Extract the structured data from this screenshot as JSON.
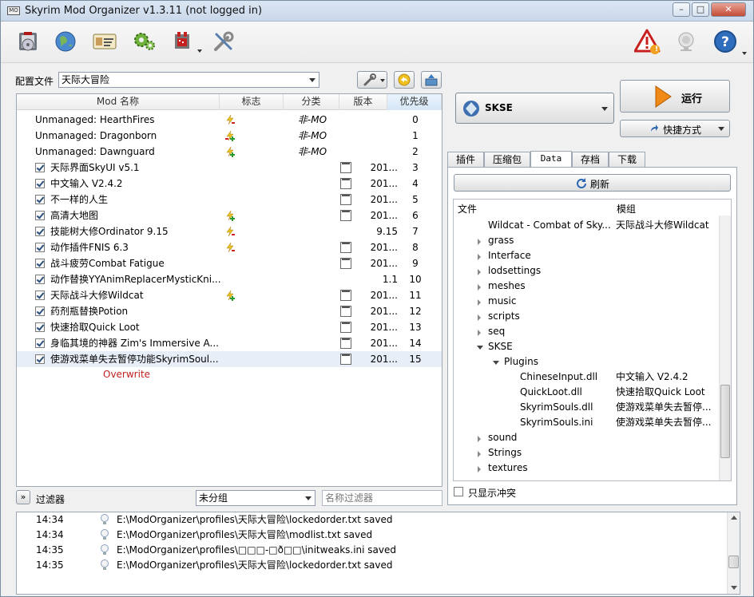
{
  "window": {
    "title": "Skyrim Mod Organizer v1.3.11 (not logged in)",
    "app_icon_text": "MO"
  },
  "toolbar": {
    "icons_left": [
      "install-mod-icon",
      "nexus-globe-icon",
      "profiles-card-icon",
      "executables-gears-icon",
      "tools-plugin-icon",
      "settings-wrench-icon"
    ],
    "icons_right": [
      "problems-warning-icon",
      "update-icon",
      "help-icon"
    ],
    "warning_badge": "!"
  },
  "profile": {
    "label": "配置文件",
    "value": "天际大冒险"
  },
  "modlist": {
    "headers": [
      "Mod 名称",
      "标志",
      "分类",
      "版本",
      "优先级"
    ],
    "rows": [
      {
        "name": "Unmanaged: HearthFires",
        "checkbox": false,
        "flag": "red",
        "category": "非-MO",
        "version": "",
        "priority": "0"
      },
      {
        "name": "Unmanaged: Dragonborn",
        "checkbox": false,
        "flag": "multi",
        "category": "非-MO",
        "version": "",
        "priority": "1"
      },
      {
        "name": "Unmanaged: Dawnguard",
        "checkbox": false,
        "flag": "green",
        "category": "非-MO",
        "version": "",
        "priority": "2"
      },
      {
        "name": "天际界面SkyUI v5.1",
        "checkbox": true,
        "flag": "",
        "category": "",
        "version": "201...",
        "cal": true,
        "priority": "3"
      },
      {
        "name": "中文输入 V2.4.2",
        "checkbox": true,
        "flag": "",
        "category": "",
        "version": "201...",
        "cal": true,
        "priority": "4"
      },
      {
        "name": "不一样的人生",
        "checkbox": true,
        "flag": "",
        "category": "",
        "version": "201...",
        "cal": true,
        "priority": "5"
      },
      {
        "name": "高清大地图",
        "checkbox": true,
        "flag": "green",
        "category": "",
        "version": "201...",
        "cal": true,
        "priority": "6"
      },
      {
        "name": "技能树大修Ordinator 9.15",
        "checkbox": true,
        "flag": "red",
        "category": "",
        "version": "9.15",
        "cal": false,
        "priority": "7"
      },
      {
        "name": "动作插件FNIS 6.3",
        "checkbox": true,
        "flag": "red",
        "category": "",
        "version": "201...",
        "cal": true,
        "priority": "8"
      },
      {
        "name": "战斗疲劳Combat Fatigue",
        "checkbox": true,
        "flag": "",
        "category": "",
        "version": "201...",
        "cal": true,
        "priority": "9"
      },
      {
        "name": "动作替换YYAnimReplacerMysticKni...",
        "checkbox": true,
        "flag": "",
        "category": "",
        "version": "1.1",
        "cal": false,
        "priority": "10"
      },
      {
        "name": "天际战斗大修Wildcat",
        "checkbox": true,
        "flag": "green",
        "category": "",
        "version": "201...",
        "cal": true,
        "priority": "11"
      },
      {
        "name": "药剂瓶替换Potion",
        "checkbox": true,
        "flag": "",
        "category": "",
        "version": "201...",
        "cal": true,
        "priority": "12"
      },
      {
        "name": "快速拾取Quick Loot",
        "checkbox": true,
        "flag": "",
        "category": "",
        "version": "201...",
        "cal": true,
        "priority": "13"
      },
      {
        "name": "身临其境的神器 Zim's Immersive A...",
        "checkbox": true,
        "flag": "",
        "category": "",
        "version": "201...",
        "cal": true,
        "priority": "14"
      },
      {
        "name": "使游戏菜单失去暂停功能SkyrimSoul...",
        "checkbox": true,
        "flag": "",
        "category": "",
        "version": "201...",
        "cal": true,
        "priority": "15"
      }
    ],
    "overwrite": "Overwrite"
  },
  "filter": {
    "toggle": "»",
    "label": "过滤器",
    "group_value": "未分组",
    "name_placeholder": "名称过滤器"
  },
  "run": {
    "exe": "SKSE",
    "run_label": "运行",
    "shortcut_label": "快捷方式"
  },
  "tabs": [
    "插件",
    "压缩包",
    "Data",
    "存档",
    "下载"
  ],
  "data_tab": {
    "refresh": "刷新",
    "headers": [
      "文件",
      "模组"
    ],
    "rows": [
      {
        "indent": 0,
        "name": "Wildcat - Combat of Sky...",
        "mod": "天际战斗大修Wildcat",
        "arrow": "none"
      },
      {
        "indent": 0,
        "name": "grass",
        "mod": "",
        "arrow": "closed"
      },
      {
        "indent": 0,
        "name": "Interface",
        "mod": "",
        "arrow": "closed"
      },
      {
        "indent": 0,
        "name": "lodsettings",
        "mod": "",
        "arrow": "closed"
      },
      {
        "indent": 0,
        "name": "meshes",
        "mod": "",
        "arrow": "closed"
      },
      {
        "indent": 0,
        "name": "music",
        "mod": "",
        "arrow": "closed"
      },
      {
        "indent": 0,
        "name": "scripts",
        "mod": "",
        "arrow": "closed"
      },
      {
        "indent": 0,
        "name": "seq",
        "mod": "",
        "arrow": "closed"
      },
      {
        "indent": 0,
        "name": "SKSE",
        "mod": "",
        "arrow": "open"
      },
      {
        "indent": 1,
        "name": "Plugins",
        "mod": "",
        "arrow": "open"
      },
      {
        "indent": 2,
        "name": "ChineseInput.dll",
        "mod": "中文输入 V2.4.2",
        "arrow": "none"
      },
      {
        "indent": 2,
        "name": "QuickLoot.dll",
        "mod": "快速拾取Quick Loot",
        "arrow": "none"
      },
      {
        "indent": 2,
        "name": "SkyrimSouls.dll",
        "mod": "使游戏菜单失去暂停...",
        "arrow": "none"
      },
      {
        "indent": 2,
        "name": "SkyrimSouls.ini",
        "mod": "使游戏菜单失去暂停...",
        "arrow": "none"
      },
      {
        "indent": 0,
        "name": "sound",
        "mod": "",
        "arrow": "closed"
      },
      {
        "indent": 0,
        "name": "Strings",
        "mod": "",
        "arrow": "closed"
      },
      {
        "indent": 0,
        "name": "textures",
        "mod": "",
        "arrow": "closed"
      }
    ],
    "conflicts_only": "只显示冲突"
  },
  "log": [
    {
      "time": "14:34",
      "msg": "E:\\ModOrganizer\\profiles\\天际大冒险\\lockedorder.txt saved"
    },
    {
      "time": "14:34",
      "msg": "E:\\ModOrganizer\\profiles\\天际大冒险\\modlist.txt saved"
    },
    {
      "time": "14:35",
      "msg": "E:\\ModOrganizer\\profiles\\□□□-□ð□□\\initweaks.ini saved"
    },
    {
      "time": "14:35",
      "msg": "E:\\ModOrganizer\\profiles\\天际大冒险\\lockedorder.txt saved"
    }
  ],
  "colors": {
    "overwrite": "#c02020",
    "run_arrow": "#f08a16",
    "selection": "#e8eef7",
    "accent": "#2c4f7f"
  }
}
